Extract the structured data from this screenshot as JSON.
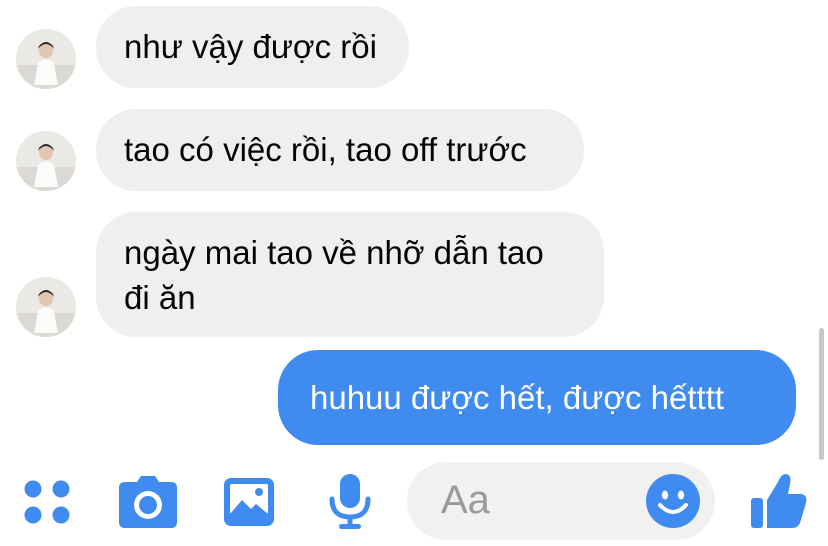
{
  "messages": [
    {
      "direction": "incoming",
      "text": "như vậy được rồi"
    },
    {
      "direction": "incoming",
      "text": "tao có việc rồi, tao off trước"
    },
    {
      "direction": "incoming",
      "text": "ngày mai tao về nhỡ dẫn tao\nđi ăn"
    },
    {
      "direction": "outgoing",
      "text": "huhuu được hết, được hếtttt"
    }
  ],
  "composer": {
    "placeholder": "Aa"
  },
  "toolbar_icons": [
    "apps-icon",
    "camera-icon",
    "gallery-icon",
    "microphone-icon",
    "emoji-icon",
    "thumbs-up-icon"
  ],
  "colors": {
    "accent": "#3f8bef",
    "incoming_bubble": "#efefef",
    "composer_bg": "#f1f1f1"
  }
}
